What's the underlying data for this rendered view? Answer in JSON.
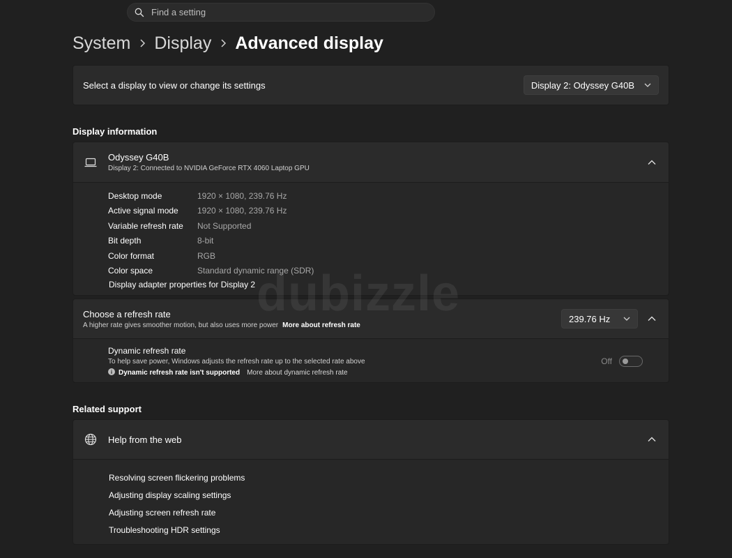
{
  "search": {
    "placeholder": "Find a setting"
  },
  "breadcrumb": [
    "System",
    "Display",
    "Advanced display"
  ],
  "display_select": {
    "label": "Select a display to view or change its settings",
    "selected": "Display 2: Odyssey G40B"
  },
  "display_info": {
    "section_title": "Display information",
    "name": "Odyssey G40B",
    "subtitle": "Display 2: Connected to NVIDIA GeForce RTX 4060 Laptop GPU",
    "rows": [
      {
        "key": "Desktop mode",
        "value": "1920 × 1080, 239.76 Hz"
      },
      {
        "key": "Active signal mode",
        "value": "1920 × 1080, 239.76 Hz"
      },
      {
        "key": "Variable refresh rate",
        "value": "Not Supported"
      },
      {
        "key": "Bit depth",
        "value": "8-bit"
      },
      {
        "key": "Color format",
        "value": "RGB"
      },
      {
        "key": "Color space",
        "value": "Standard dynamic range (SDR)"
      }
    ],
    "adapter_link": "Display adapter properties for Display 2"
  },
  "refresh": {
    "title": "Choose a refresh rate",
    "subtitle": "A higher rate gives smoother motion, but also uses more power",
    "more_link": "More about refresh rate",
    "selected": "239.76 Hz"
  },
  "dynamic_refresh": {
    "title": "Dynamic refresh rate",
    "subtitle": "To help save power, Windows adjusts the refresh rate up to the selected rate above",
    "warning": "Dynamic refresh rate isn't supported",
    "more_link": "More about dynamic refresh rate",
    "toggle_state": "Off"
  },
  "related_support": {
    "section_title": "Related support",
    "title": "Help from the web",
    "links": [
      "Resolving screen flickering problems",
      "Adjusting display scaling settings",
      "Adjusting screen refresh rate",
      "Troubleshooting HDR settings"
    ]
  },
  "watermark": "dubizzle",
  "colors": {
    "background": "#202020",
    "card": "#2b2b2b",
    "card_body": "#272727"
  }
}
